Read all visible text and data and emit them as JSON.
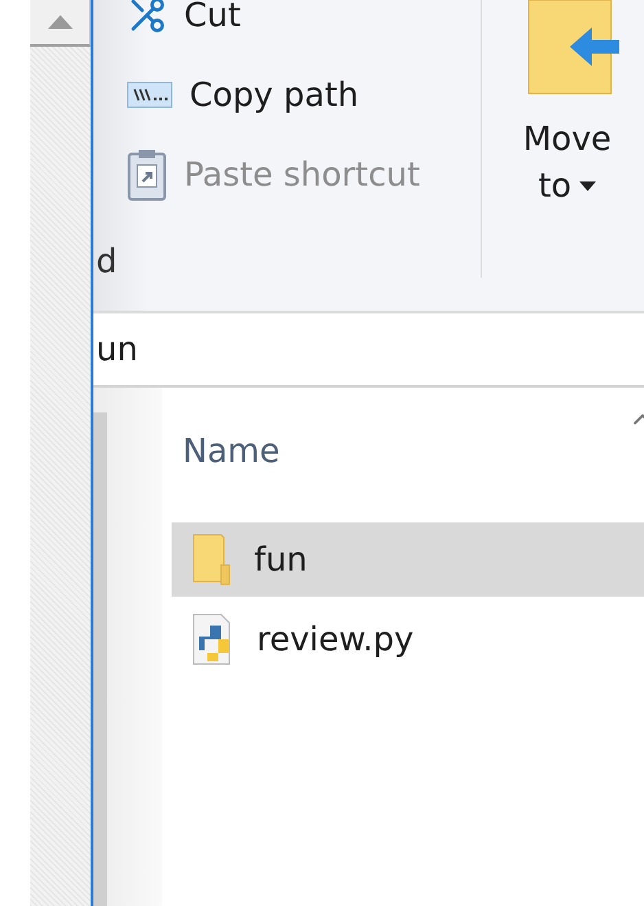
{
  "ribbon": {
    "clipboard_items": [
      {
        "label": "Cut",
        "kind": "cut",
        "disabled": false
      },
      {
        "label": "Copy path",
        "kind": "copy_path",
        "disabled": false
      },
      {
        "label": "Paste shortcut",
        "kind": "paste_shortcut",
        "disabled": true
      }
    ],
    "group_label": "d",
    "move_to": {
      "label_lines": [
        "Move",
        "to"
      ]
    }
  },
  "address_bar": {
    "path": "un"
  },
  "file_list": {
    "columns": [
      {
        "label": "Name"
      }
    ],
    "items": [
      {
        "name": "fun",
        "kind": "folder",
        "selected": true
      },
      {
        "name": "review.py",
        "kind": "python",
        "selected": false
      }
    ]
  }
}
